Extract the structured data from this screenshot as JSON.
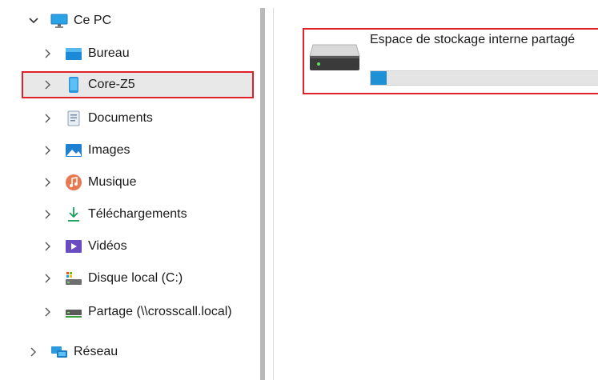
{
  "nav": {
    "items": [
      {
        "id": "ce-pc",
        "label": "Ce PC",
        "icon": "computer-icon",
        "expanded": true
      },
      {
        "id": "bureau",
        "label": "Bureau",
        "icon": "desktop-folder-icon"
      },
      {
        "id": "core-z5",
        "label": "Core-Z5",
        "icon": "phone-icon",
        "selected": true
      },
      {
        "id": "documents",
        "label": "Documents",
        "icon": "documents-folder-icon"
      },
      {
        "id": "images",
        "label": "Images",
        "icon": "pictures-folder-icon"
      },
      {
        "id": "musique",
        "label": "Musique",
        "icon": "music-folder-icon"
      },
      {
        "id": "telechargements",
        "label": "Téléchargements",
        "icon": "downloads-icon"
      },
      {
        "id": "videos",
        "label": "Vidéos",
        "icon": "videos-folder-icon"
      },
      {
        "id": "disque-local",
        "label": "Disque local (C:)",
        "icon": "local-disk-icon"
      },
      {
        "id": "partage",
        "label": "Partage (\\\\crosscall.local)",
        "icon": "network-drive-icon"
      },
      {
        "id": "reseau",
        "label": "Réseau",
        "icon": "network-icon"
      }
    ]
  },
  "content": {
    "device": {
      "name": "Espace de stockage interne partagé",
      "icon": "drive-icon",
      "usage_fraction": 0.07
    }
  },
  "colors": {
    "highlight_border": "#e0212a",
    "selected_bg": "#e8e8e8",
    "usage_fill": "#1e90d6"
  }
}
